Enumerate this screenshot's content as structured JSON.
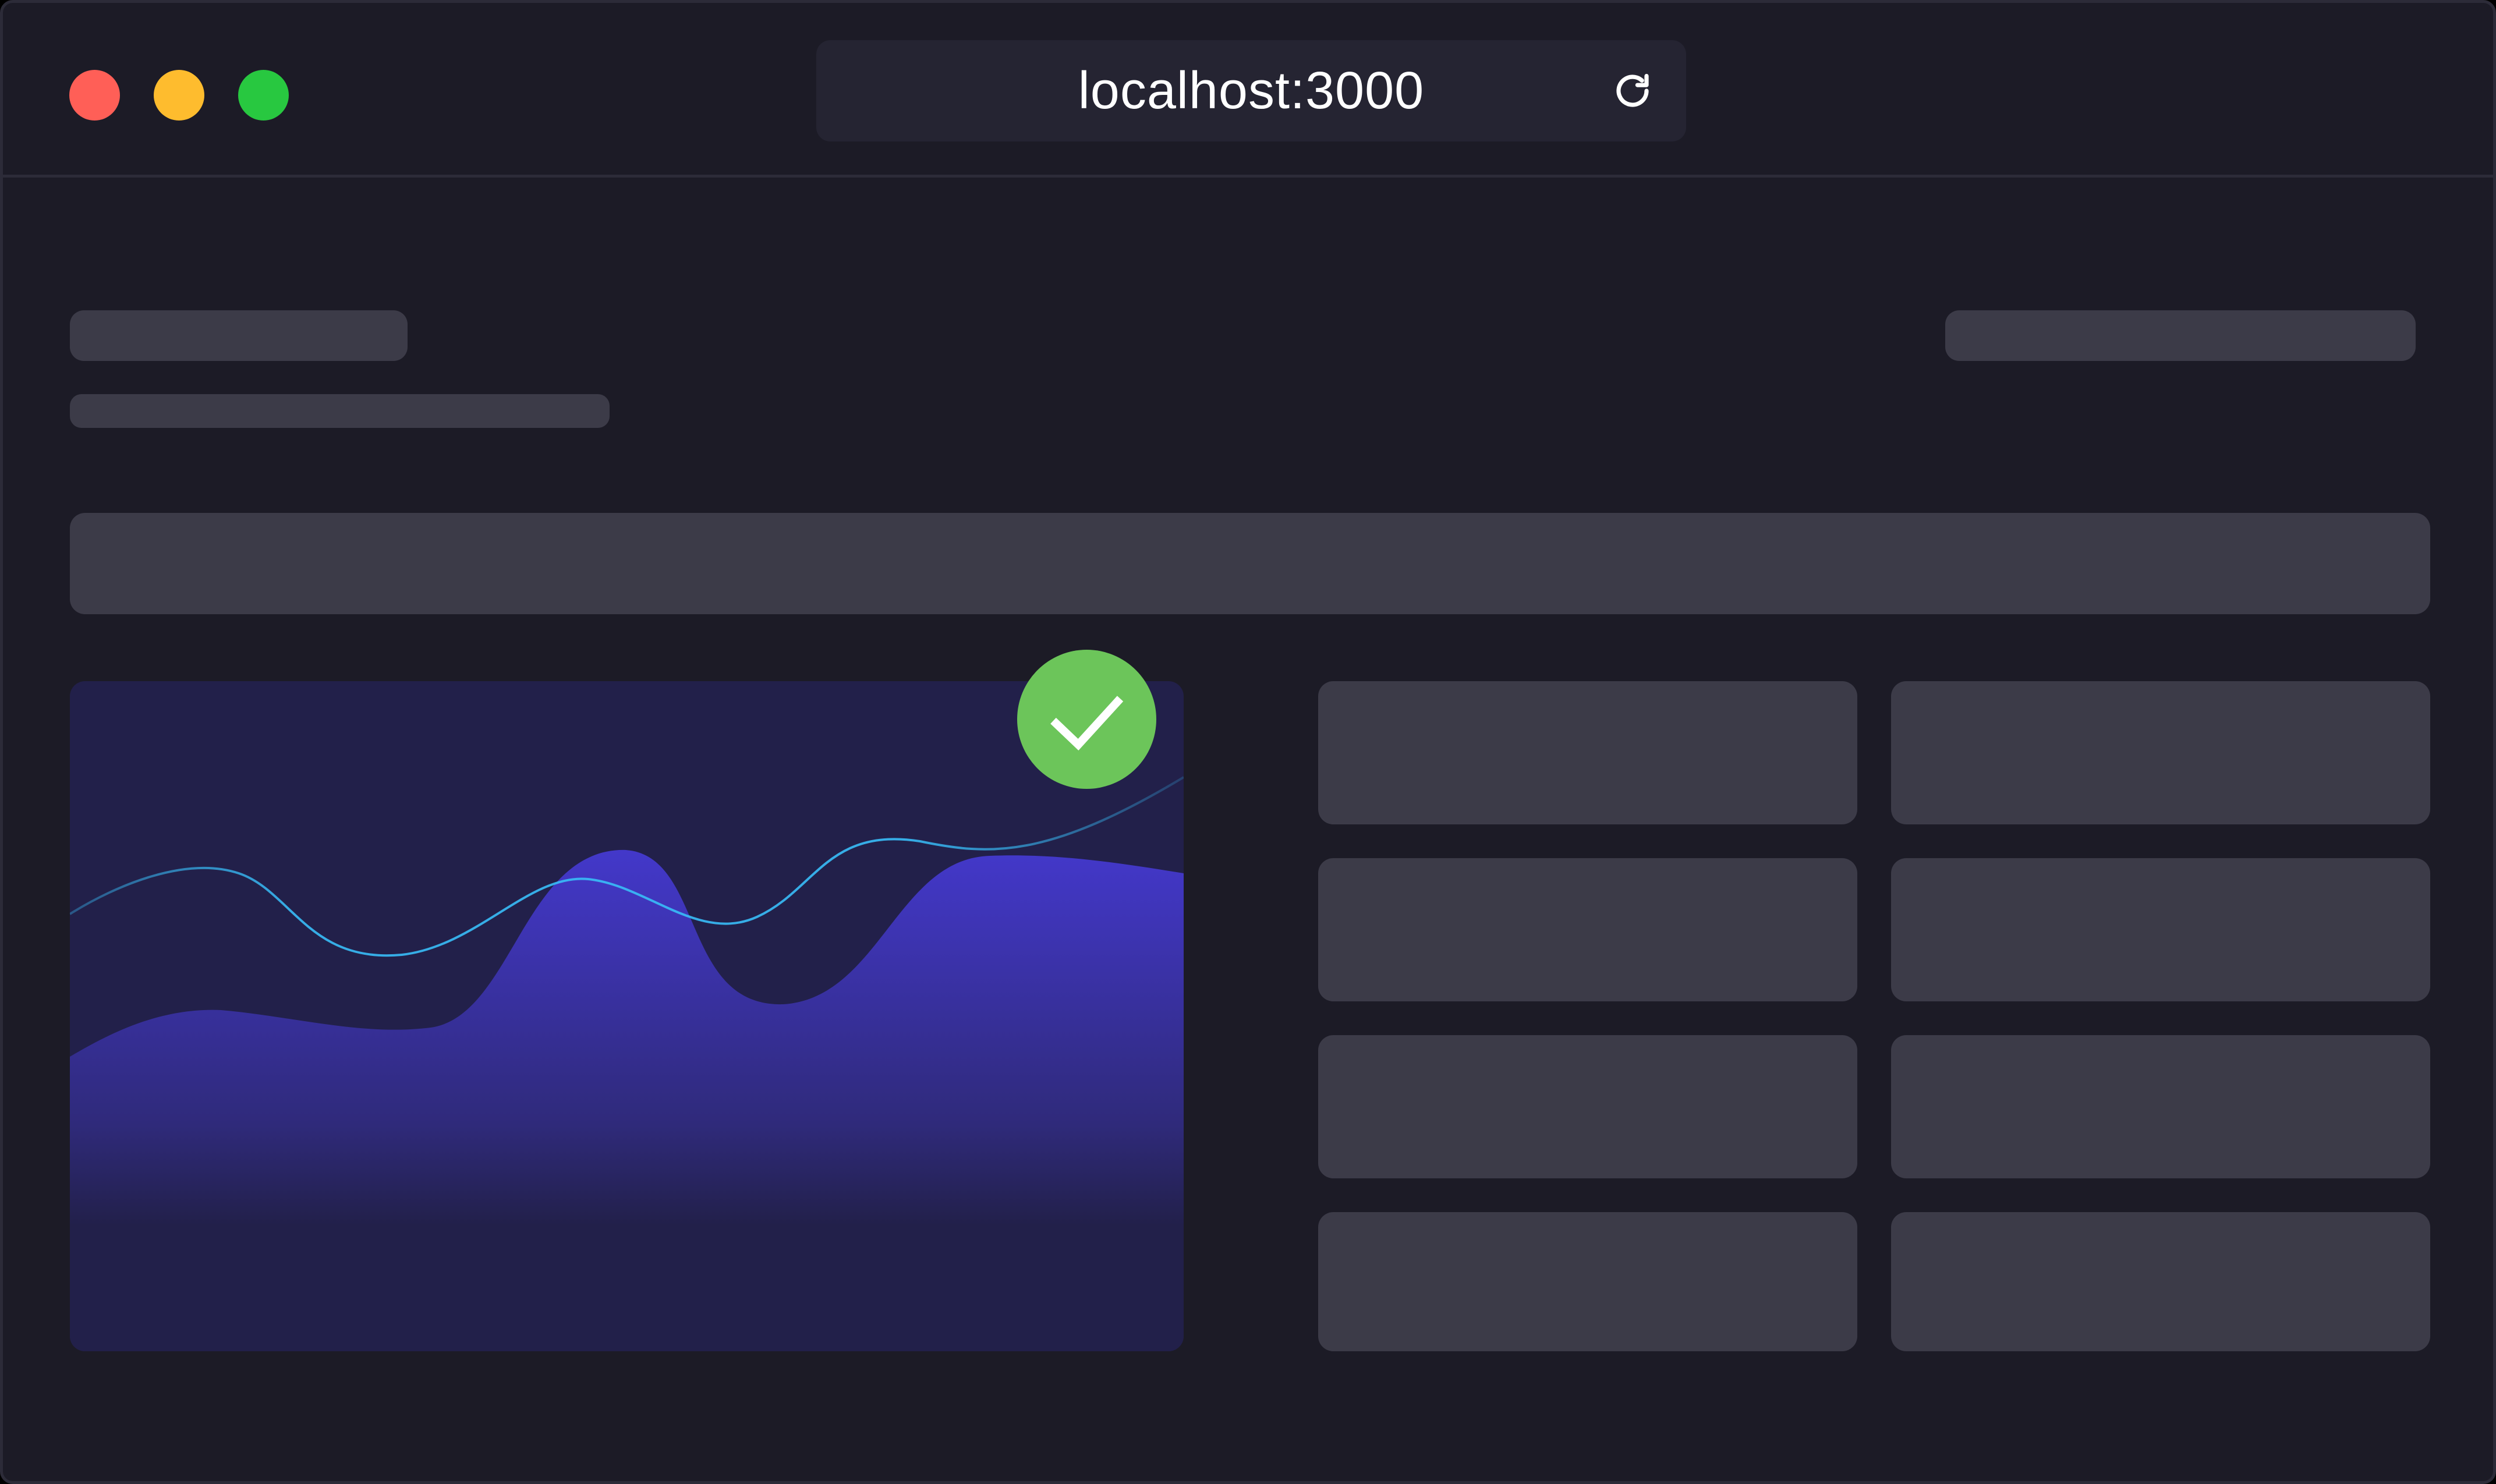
{
  "browser": {
    "url": "localhost:3000",
    "controls": {
      "close_color": "#ff5f57",
      "minimize_color": "#febc2e",
      "maximize_color": "#28c840"
    },
    "reload_icon": "reload-icon"
  },
  "colors": {
    "background": "#1c1b26",
    "skeleton": "#3c3b48",
    "chart_background": "#22204a",
    "area_fill": "#4338ca",
    "line_stroke": "#38bdf8",
    "success": "#6cc55a"
  },
  "status": {
    "icon": "check-icon",
    "state": "success"
  }
}
